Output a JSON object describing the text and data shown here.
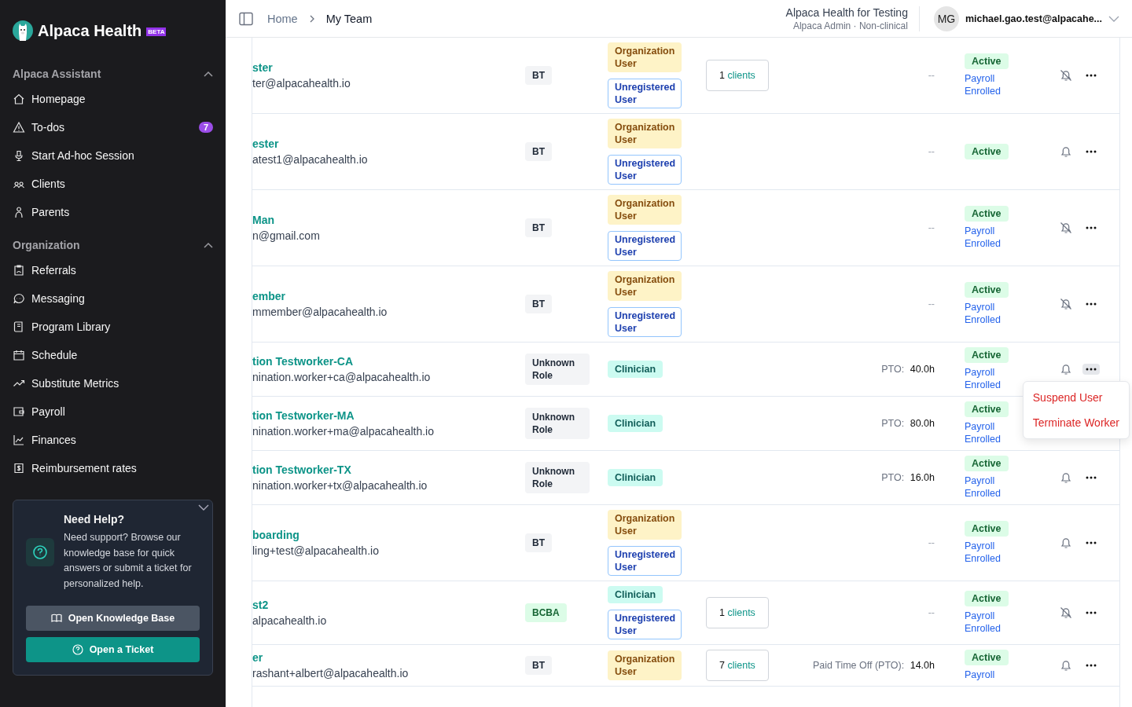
{
  "sidebar": {
    "brand": {
      "name": "Alpaca Health",
      "badge": "BETA"
    },
    "sections": [
      {
        "title": "Alpaca Assistant",
        "expanded": true,
        "items": [
          {
            "label": "Homepage"
          },
          {
            "label": "To-dos",
            "badge": "7"
          },
          {
            "label": "Start Ad-hoc Session"
          },
          {
            "label": "Clients"
          },
          {
            "label": "Parents"
          }
        ]
      },
      {
        "title": "Organization",
        "expanded": true,
        "items": [
          {
            "label": "Referrals"
          },
          {
            "label": "Messaging"
          },
          {
            "label": "Program Library"
          },
          {
            "label": "Schedule"
          },
          {
            "label": "Substitute Metrics"
          },
          {
            "label": "Payroll"
          },
          {
            "label": "Finances"
          },
          {
            "label": "Reimbursement rates"
          }
        ]
      }
    ],
    "help": {
      "title": "Need Help?",
      "text": "Need support? Browse our knowledge base for quick answers or submit a ticket for personalized help.",
      "buttons": [
        {
          "kind": "secondary",
          "label": "Open Knowledge Base"
        },
        {
          "kind": "primary",
          "label": "Open a Ticket"
        }
      ]
    }
  },
  "header": {
    "breadcrumbs": [
      "Home",
      "My Team"
    ],
    "org": {
      "name": "Alpaca Health for Testing",
      "subtitle": "Alpaca Admin · Non-clinical"
    },
    "user": {
      "initials": "MG",
      "email": "michael.gao.test@alpacahe..."
    }
  },
  "action_menu": {
    "items": [
      "Suspend User",
      "Terminate Worker"
    ]
  },
  "rows": [
    {
      "name": "ster",
      "email": "ter@alpacahealth.io",
      "role": {
        "label": "BT",
        "kind": "neutral"
      },
      "tags": [
        {
          "label": "Organization User",
          "kind": "org"
        },
        {
          "label": "Unregistered User",
          "kind": "unregistered"
        }
      ],
      "clients": {
        "count": "1",
        "unit": "clients"
      },
      "pto": {
        "value": "--"
      },
      "status": "Active",
      "payroll": "Payroll Enrolled",
      "notifications": false,
      "menu_open": false
    },
    {
      "name": "ester",
      "email": "atest1@alpacahealth.io",
      "role": {
        "label": "BT",
        "kind": "neutral"
      },
      "tags": [
        {
          "label": "Organization User",
          "kind": "org"
        },
        {
          "label": "Unregistered User",
          "kind": "unregistered"
        }
      ],
      "pto": {
        "value": "--"
      },
      "status": "Active",
      "notifications": true,
      "menu_open": false
    },
    {
      "name": "Man",
      "email": "n@gmail.com",
      "role": {
        "label": "BT",
        "kind": "neutral"
      },
      "tags": [
        {
          "label": "Organization User",
          "kind": "org"
        },
        {
          "label": "Unregistered User",
          "kind": "unregistered"
        }
      ],
      "pto": {
        "value": "--"
      },
      "status": "Active",
      "payroll": "Payroll Enrolled",
      "notifications": false,
      "menu_open": false
    },
    {
      "name": "ember",
      "email": "mmember@alpacahealth.io",
      "role": {
        "label": "BT",
        "kind": "neutral"
      },
      "tags": [
        {
          "label": "Organization User",
          "kind": "org"
        },
        {
          "label": "Unregistered User",
          "kind": "unregistered"
        }
      ],
      "pto": {
        "value": "--"
      },
      "status": "Active",
      "payroll": "Payroll Enrolled",
      "notifications": false,
      "menu_open": false
    },
    {
      "name": "tion Testworker-CA",
      "email": "nination.worker+ca@alpacahealth.io",
      "role": {
        "label": "Unknown Role",
        "kind": "neutral"
      },
      "tags": [
        {
          "label": "Clinician",
          "kind": "clinician"
        }
      ],
      "pto": {
        "label": "PTO:",
        "value": "40.0h"
      },
      "status": "Active",
      "payroll": "Payroll Enrolled",
      "notifications": true,
      "menu_open": true
    },
    {
      "name": "tion Testworker-MA",
      "email": "nination.worker+ma@alpacahealth.io",
      "role": {
        "label": "Unknown Role",
        "kind": "neutral"
      },
      "tags": [
        {
          "label": "Clinician",
          "kind": "clinician"
        }
      ],
      "pto": {
        "label": "PTO:",
        "value": "80.0h"
      },
      "status": "Active",
      "payroll": "Payroll Enrolled"
    },
    {
      "name": "tion Testworker-TX",
      "email": "nination.worker+tx@alpacahealth.io",
      "role": {
        "label": "Unknown Role",
        "kind": "neutral"
      },
      "tags": [
        {
          "label": "Clinician",
          "kind": "clinician"
        }
      ],
      "pto": {
        "label": "PTO:",
        "value": "16.0h"
      },
      "status": "Active",
      "payroll": "Payroll Enrolled",
      "notifications": true,
      "menu_open": false
    },
    {
      "name": "boarding",
      "email": "ling+test@alpacahealth.io",
      "role": {
        "label": "BT",
        "kind": "neutral"
      },
      "tags": [
        {
          "label": "Organization User",
          "kind": "org"
        },
        {
          "label": "Unregistered User",
          "kind": "unregistered"
        }
      ],
      "pto": {
        "value": "--"
      },
      "status": "Active",
      "payroll": "Payroll Enrolled",
      "notifications": true,
      "menu_open": false
    },
    {
      "name": "st2",
      "email": "alpacahealth.io",
      "role": {
        "label": "BCBA",
        "kind": "green"
      },
      "tags": [
        {
          "label": "Clinician",
          "kind": "clinician"
        },
        {
          "label": "Unregistered User",
          "kind": "unregistered"
        }
      ],
      "clients": {
        "count": "1",
        "unit": "clients"
      },
      "pto": {
        "value": "--"
      },
      "status": "Active",
      "payroll": "Payroll Enrolled",
      "notifications": false,
      "menu_open": false
    },
    {
      "name": "er",
      "email": "rashant+albert@alpacahealth.io",
      "role": {
        "label": "BT",
        "kind": "neutral"
      },
      "tags": [
        {
          "label": "Organization User",
          "kind": "org"
        }
      ],
      "clients": {
        "count": "7",
        "unit": "clients"
      },
      "pto": {
        "label": "Paid Time Off (PTO):",
        "value": "14.0h"
      },
      "status": "Active",
      "payroll": "Payroll",
      "notifications": true,
      "menu_open": false
    }
  ]
}
